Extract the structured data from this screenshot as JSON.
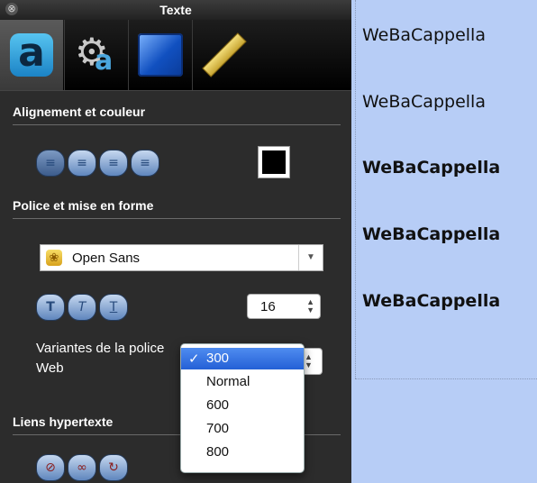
{
  "window": {
    "title": "Texte"
  },
  "toolbar": {
    "tabs": [
      {
        "icon": "text-a-icon",
        "glyph": "a"
      },
      {
        "icon": "gear-icon",
        "glyph": "⚙",
        "badge": "a"
      },
      {
        "icon": "blue-square-icon"
      },
      {
        "icon": "ruler-icon"
      }
    ]
  },
  "sections": {
    "alignment": "Alignement et couleur",
    "font": "Police et mise en forme",
    "links": "Liens hypertexte"
  },
  "alignment": {
    "buttons": [
      "align-left-icon",
      "align-center-icon",
      "align-justify-icon",
      "align-right-icon"
    ],
    "color": "#000000"
  },
  "font": {
    "family": "Open Sans",
    "size": "16",
    "style_buttons": [
      "text-bold-icon",
      "text-italic-icon",
      "text-underline-icon"
    ],
    "variants_label": "Variantes de la police Web",
    "variants": [
      "300",
      "Normal",
      "600",
      "700",
      "800"
    ],
    "selected_variant": "300"
  },
  "links": {
    "buttons": [
      "link-remove-icon",
      "link-add-icon",
      "link-refresh-icon"
    ]
  },
  "canvas": {
    "samples": [
      "WeBaCappella",
      "WeBaCappella",
      "WeBaCappella",
      "WeBaCappella",
      "WeBaCappella"
    ],
    "background": "#b7cdf6"
  }
}
